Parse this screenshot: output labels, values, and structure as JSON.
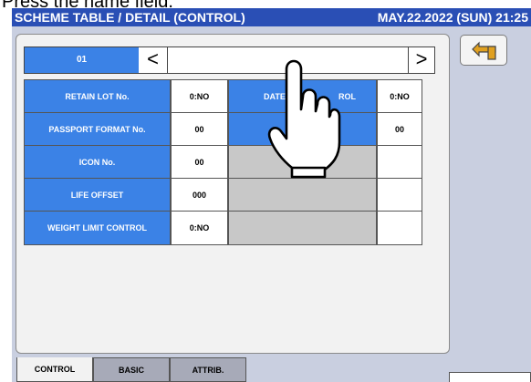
{
  "instruction": "Press the name field.",
  "header": {
    "title": "SCHEME TABLE / DETAIL (CONTROL)",
    "datetime": "MAY.22.2022 (SUN) 21:25"
  },
  "record": {
    "code": "01",
    "prev_glyph": "<",
    "next_glyph": ">",
    "name": ""
  },
  "rows": [
    {
      "label": "RETAIN LOT No.",
      "value": "0:NO"
    },
    {
      "label": "PASSPORT FORMAT No.",
      "value": "00"
    },
    {
      "label": "ICON No.",
      "value": "00"
    },
    {
      "label": "LIFE OFFSET",
      "value": "000"
    },
    {
      "label": "WEIGHT LIMIT CONTROL",
      "value": "0:NO"
    }
  ],
  "right_rows": [
    {
      "label": "DATE ... CONTROL",
      "label_visible_left": "DATE",
      "label_visible_right": "ROL",
      "value": "0:NO"
    },
    {
      "label": "",
      "value": "00"
    }
  ],
  "tabs": [
    {
      "label": "CONTROL",
      "active": true
    },
    {
      "label": "BASIC",
      "active": false
    },
    {
      "label": "ATTRIB.",
      "active": false
    }
  ],
  "icons": {
    "back": "return-arrow-icon",
    "pointer": "pointing-hand-icon"
  },
  "colors": {
    "title_bar": "#2a4fb5",
    "label_blue": "#3b82e6",
    "screen_bg": "#c9cfe0",
    "disabled_gray": "#c8c8c8",
    "back_arrow": "#e0a020"
  }
}
